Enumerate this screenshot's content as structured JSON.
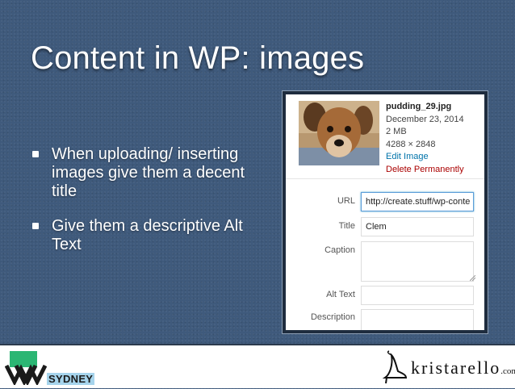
{
  "slide": {
    "title": "Content in WP: images",
    "bullets": [
      "When uploading/ inserting images give them a decent title",
      "Give them a descriptive Alt Text"
    ]
  },
  "attachment": {
    "filename": "pudding_29.jpg",
    "date": "December 23, 2014",
    "size": "2 MB",
    "dimensions": "4288 × 2848",
    "edit_link": "Edit Image",
    "delete_link": "Delete Permanently",
    "fields": {
      "url_label": "URL",
      "url_value": "http://create.stuff/wp-conte",
      "title_label": "Title",
      "title_value": "Clem",
      "caption_label": "Caption",
      "caption_value": "",
      "alt_label": "Alt Text",
      "alt_value": "",
      "description_label": "Description",
      "description_value": ""
    },
    "colors": {
      "link": "#0073aa",
      "delete": "#aa0000",
      "focus": "#5b9dd9"
    }
  },
  "footer": {
    "left_logo_text": "SYDNEY",
    "right_logo_text": "kristarello",
    "right_logo_suffix": ".com",
    "colors": {
      "green": "#2bb673",
      "dark": "#1a1a1a"
    }
  }
}
